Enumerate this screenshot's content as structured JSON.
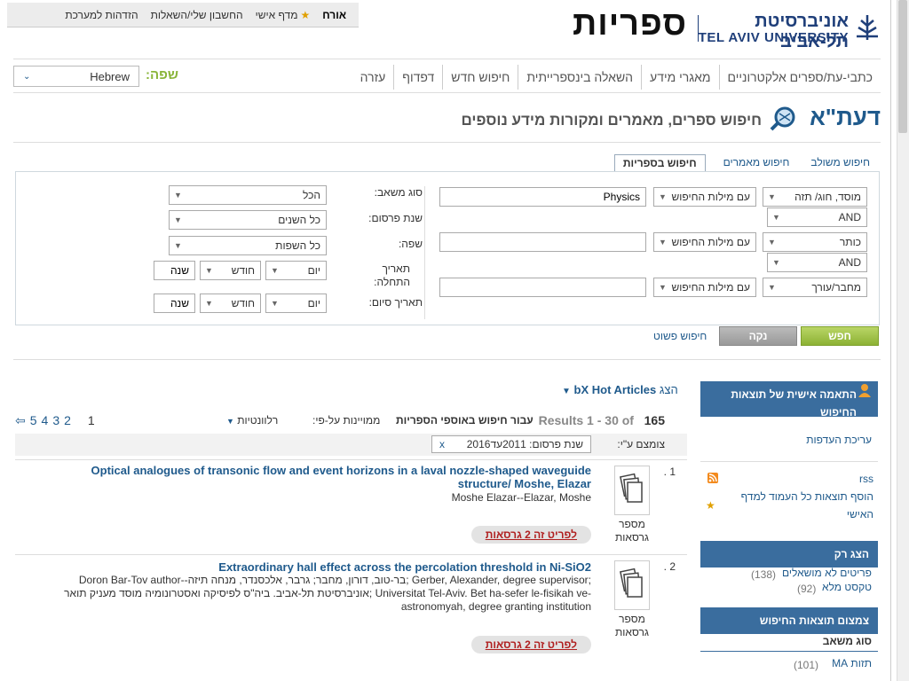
{
  "topbar": {
    "guest": "אורח",
    "eshelf": "מדף אישי",
    "account": "החשבון שלי/השאלות",
    "login": "הזדהות למערכת"
  },
  "logo": {
    "site": "ספריות",
    "univ_he": "אוניברסיטת תל-אביב",
    "univ_en": "TEL AVIV UNIVERSITY"
  },
  "nav": [
    "כתבי-עת/ספרים אלקטרוניים",
    "מאגרי מידע",
    "השאלה בינספרייתית",
    "חיפוש חדש",
    "דפדוף",
    "עזרה"
  ],
  "language": {
    "label": "שפה:",
    "value": "Hebrew"
  },
  "header": {
    "brand": "דעת\"א",
    "subtitle": "חיפוש ספרים, מאמרים ומקורות מידע נוספים"
  },
  "tabs": [
    "חיפוש משולב",
    "חיפוש מאמרים",
    "חיפוש בספריות"
  ],
  "form": {
    "rows": [
      {
        "field": "מוסד, חוג/ תזה",
        "match": "עם מילות החיפוש",
        "value": "Physics"
      },
      {
        "field": "כותר",
        "match": "עם מילות החיפוש",
        "value": ""
      },
      {
        "field": "מחבר/עורך",
        "match": "עם מילות החיפוש",
        "value": ""
      }
    ],
    "ops": [
      "AND",
      "AND"
    ],
    "filters": [
      {
        "label": "סוג משאב:",
        "value": "הכל"
      },
      {
        "label": "שנת פרסום:",
        "value": "כל השנים"
      },
      {
        "label": "שפה:",
        "value": "כל השפות"
      }
    ],
    "start_label": "תאריך התחלה:",
    "end_label": "תאריך סיום:",
    "day": "יום",
    "month": "חודש",
    "year": "שנה"
  },
  "buttons": {
    "search": "חפש",
    "clear": "נקה",
    "simple": "חיפוש פשוט"
  },
  "results": {
    "bx_prefix": "הצג",
    "bx_label": "bX Hot Articles",
    "total": "165",
    "range": "Results 1 - 30 of",
    "scope": "עבור חיפוש באוספי הספריות",
    "sort_label": "ממויינות על-פי:",
    "sort_value": "רלוונטיות",
    "pages": [
      "1",
      "2",
      "3",
      "4",
      "5"
    ],
    "filter_label": "צומצם ע\"י:",
    "chip": "שנת פרסום: 2011עד2016",
    "items": [
      {
        "num": "1 .",
        "title": "Optical analogues of transonic flow and event horizons in a laval nozzle-shaped waveguide structure/ Moshe, Elazar",
        "authors": "Moshe Elazar--Elazar, Moshe",
        "icon_label": "מספר גרסאות",
        "versions": "לפריט זה 2 גרסאות"
      },
      {
        "num": "2 .",
        "title": "Extraordinary hall effect across the percolation threshold in Ni-SiO2",
        "authors": "Doron Bar-Tov author--בר-טוב, דורון, מחבר; גרבר, אלכסנדר, מנחה תיזה; Gerber, Alexander, degree supervisor; אוניברסיטת תל-אביב. ביה\"ס לפיסיקה ואסטרונומיה מוסד מעניק תואר; Universitat Tel-Aviv. Bet ha-sefer le-fisikah ve-astronomyah, degree granting institution",
        "icon_label": "מספר גרסאות",
        "versions": "לפריט זה 2 גרסאות"
      }
    ]
  },
  "sidebar": {
    "personalize": "התאמה אישית של תוצאות החיפוש",
    "prefs": "עריכת העדפות",
    "rss": "rss",
    "add_eshelf": "הוסף תוצאות כל העמוד למדף האישי",
    "show_only": "הצג רק",
    "only": [
      {
        "label": "פריטים לא מושאלים",
        "count": "(138)"
      },
      {
        "label": "טקסט מלא",
        "count": "(92)"
      }
    ],
    "refine": "צמצום תוצאות החיפוש",
    "resource_type": "סוג משאב",
    "partial": "תזות MA",
    "partial_count": "(101)"
  },
  "colors": {
    "brand": "#1f5a8c",
    "accent": "#8ab53a",
    "sidebar_head": "#3a6d9e"
  }
}
